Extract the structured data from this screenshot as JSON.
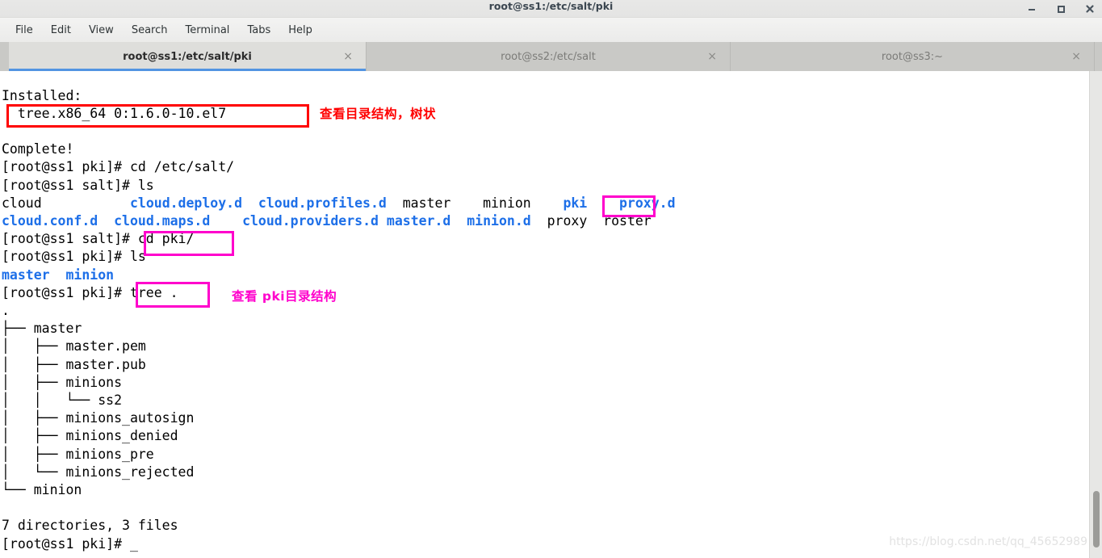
{
  "window": {
    "title": "root@ss1:/etc/salt/pki",
    "controls": {
      "minimize": "minimize",
      "maximize": "maximize",
      "close": "close"
    }
  },
  "menubar": {
    "items": [
      {
        "label": "File"
      },
      {
        "label": "Edit"
      },
      {
        "label": "View"
      },
      {
        "label": "Search"
      },
      {
        "label": "Terminal"
      },
      {
        "label": "Tabs"
      },
      {
        "label": "Help"
      }
    ]
  },
  "tabs": [
    {
      "label": "root@ss1:/etc/salt/pki",
      "active": true,
      "close": "×"
    },
    {
      "label": "root@ss2:/etc/salt",
      "active": false,
      "close": "×"
    },
    {
      "label": "root@ss3:~",
      "active": false,
      "close": "×"
    }
  ],
  "terminal": {
    "lines": [
      {
        "segments": [
          {
            "text": "Installed:",
            "color": "plain"
          }
        ]
      },
      {
        "segments": [
          {
            "text": "  tree.x86_64 0:1.6.0-10.el7",
            "color": "plain"
          }
        ]
      },
      {
        "segments": [
          {
            "text": "",
            "color": "plain"
          }
        ]
      },
      {
        "segments": [
          {
            "text": "Complete!",
            "color": "plain"
          }
        ]
      },
      {
        "segments": [
          {
            "text": "[root@ss1 pki]# cd /etc/salt/",
            "color": "plain"
          }
        ]
      },
      {
        "segments": [
          {
            "text": "[root@ss1 salt]# ls",
            "color": "plain"
          }
        ]
      },
      {
        "segments": [
          {
            "text": "cloud",
            "color": "plain"
          },
          {
            "text": "           ",
            "color": "plain"
          },
          {
            "text": "cloud.deploy.d",
            "color": "dir"
          },
          {
            "text": "  ",
            "color": "plain"
          },
          {
            "text": "cloud.profiles.d",
            "color": "dir"
          },
          {
            "text": "  master",
            "color": "plain"
          },
          {
            "text": "    minion",
            "color": "plain"
          },
          {
            "text": "    ",
            "color": "plain"
          },
          {
            "text": "pki",
            "color": "dir"
          },
          {
            "text": "    ",
            "color": "plain"
          },
          {
            "text": "proxy.d",
            "color": "dir"
          }
        ]
      },
      {
        "segments": [
          {
            "text": "cloud.conf.d",
            "color": "dir"
          },
          {
            "text": "  ",
            "color": "plain"
          },
          {
            "text": "cloud.maps.d",
            "color": "dir"
          },
          {
            "text": "    ",
            "color": "plain"
          },
          {
            "text": "cloud.providers.d",
            "color": "dir"
          },
          {
            "text": " ",
            "color": "plain"
          },
          {
            "text": "master.d",
            "color": "dir"
          },
          {
            "text": "  ",
            "color": "plain"
          },
          {
            "text": "minion.d",
            "color": "dir"
          },
          {
            "text": "  proxy  roster",
            "color": "plain"
          }
        ]
      },
      {
        "segments": [
          {
            "text": "[root@ss1 salt]# cd pki/",
            "color": "plain"
          }
        ]
      },
      {
        "segments": [
          {
            "text": "[root@ss1 pki]# ls",
            "color": "plain"
          }
        ]
      },
      {
        "segments": [
          {
            "text": "master",
            "color": "dir"
          },
          {
            "text": "  ",
            "color": "plain"
          },
          {
            "text": "minion",
            "color": "dir"
          }
        ]
      },
      {
        "segments": [
          {
            "text": "[root@ss1 pki]# tree .",
            "color": "plain"
          }
        ]
      },
      {
        "segments": [
          {
            "text": ".",
            "color": "plain"
          }
        ]
      },
      {
        "segments": [
          {
            "text": "├── master",
            "color": "plain"
          }
        ]
      },
      {
        "segments": [
          {
            "text": "│   ├── master.pem",
            "color": "plain"
          }
        ]
      },
      {
        "segments": [
          {
            "text": "│   ├── master.pub",
            "color": "plain"
          }
        ]
      },
      {
        "segments": [
          {
            "text": "│   ├── minions",
            "color": "plain"
          }
        ]
      },
      {
        "segments": [
          {
            "text": "│   │   └── ss2",
            "color": "plain"
          }
        ]
      },
      {
        "segments": [
          {
            "text": "│   ├── minions_autosign",
            "color": "plain"
          }
        ]
      },
      {
        "segments": [
          {
            "text": "│   ├── minions_denied",
            "color": "plain"
          }
        ]
      },
      {
        "segments": [
          {
            "text": "│   ├── minions_pre",
            "color": "plain"
          }
        ]
      },
      {
        "segments": [
          {
            "text": "│   └── minions_rejected",
            "color": "plain"
          }
        ]
      },
      {
        "segments": [
          {
            "text": "└── minion",
            "color": "plain"
          }
        ]
      },
      {
        "segments": [
          {
            "text": "",
            "color": "plain"
          }
        ]
      },
      {
        "segments": [
          {
            "text": "7 directories, 3 files",
            "color": "plain"
          }
        ]
      },
      {
        "segments": [
          {
            "text": "[root@ss1 pki]# _",
            "color": "plain"
          }
        ]
      }
    ]
  },
  "annotations": {
    "note_tree_structure": "查看目录结构，树状",
    "note_pki_structure": "查看 pki目录结构",
    "highlight_installed_package": "tree.x86_64 0:1.6.0-10.el7",
    "highlight_pki_entry": "pki",
    "highlight_cd_pki": "cd pki/",
    "highlight_tree_cmd": "tree ."
  },
  "colors": {
    "annotation_red": "#ff0000",
    "annotation_magenta": "#ff00cc",
    "directory_blue": "#1d6fe8",
    "tab_accent": "#5294e2"
  },
  "watermark": {
    "text": "https://blog.csdn.net/qq_45652989"
  }
}
